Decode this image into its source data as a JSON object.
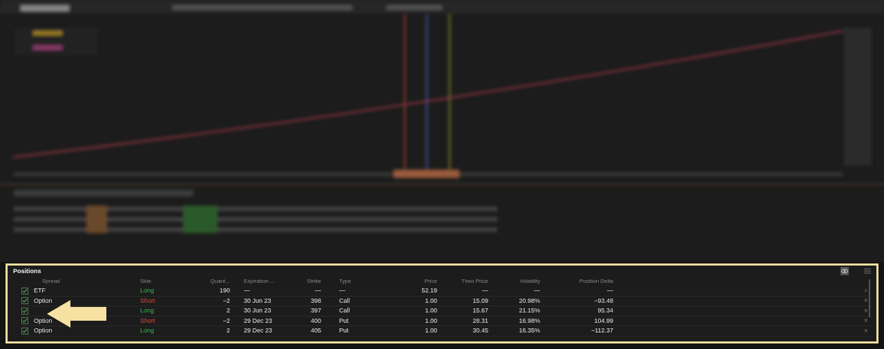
{
  "positions": {
    "title": "Positions",
    "columns": [
      "Spread",
      "Side",
      "Quant...",
      "Expiration ...",
      "Strike",
      "Type",
      "Price",
      "Theo Price",
      "Volatility",
      "Position Delta"
    ],
    "rows": [
      {
        "checked": true,
        "spread": "ETF",
        "side": "Long",
        "kind": "long",
        "quantity": "190",
        "expiration": "—",
        "strike": "—",
        "type": "—",
        "price": "52.19",
        "theo_price": "—",
        "volatility": "—",
        "position_delta": "—",
        "close": "×",
        "removable": false
      },
      {
        "checked": true,
        "spread": "Option",
        "side": "Short",
        "kind": "short",
        "quantity": "−2",
        "expiration": "30 Jun 23",
        "strike": "398",
        "type": "Call",
        "price": "1.00",
        "theo_price": "15.09",
        "volatility": "20.98%",
        "position_delta": "−93.48",
        "close": "×",
        "removable": true
      },
      {
        "checked": true,
        "side": "Long",
        "kind": "long",
        "quantity": "2",
        "expiration": "30 Jun 23",
        "strike": "397",
        "type": "Call",
        "price": "1.00",
        "theo_price": "15.67",
        "volatility": "21.15%",
        "position_delta": "95.34",
        "close": "×",
        "removable": true
      },
      {
        "checked": true,
        "spread": "Option",
        "side": "Short",
        "kind": "short",
        "quantity": "−2",
        "expiration": "29 Dec 23",
        "strike": "400",
        "type": "Put",
        "price": "1.00",
        "theo_price": "28.31",
        "volatility": "16.98%",
        "position_delta": "104.99",
        "close": "×",
        "removable": true
      },
      {
        "checked": true,
        "spread": "Option",
        "side": "Long",
        "kind": "long",
        "quantity": "2",
        "expiration": "29 Dec 23",
        "strike": "405",
        "type": "Put",
        "price": "1.00",
        "theo_price": "30.45",
        "volatility": "16.35%",
        "position_delta": "−112.37",
        "close": "×",
        "removable": true
      }
    ]
  }
}
